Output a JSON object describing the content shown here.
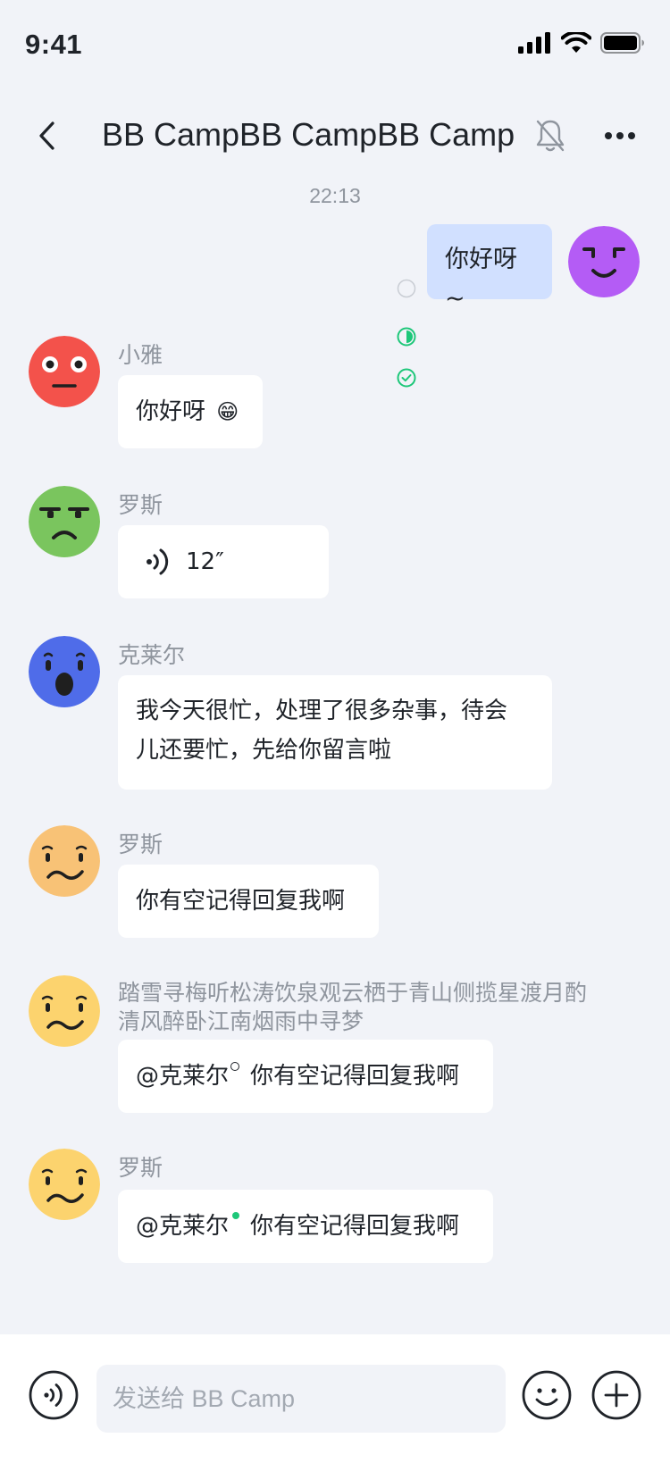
{
  "status_bar": {
    "time": "9:41"
  },
  "nav": {
    "title": "BB CampBB CampBB Camp"
  },
  "chat": {
    "timestamp": "22:13",
    "messages": [
      {
        "sender": "",
        "text": "你好呀~",
        "mine": true
      },
      {
        "sender": "小雅",
        "text": "你好呀",
        "emoji": "😁"
      },
      {
        "sender": "罗斯",
        "voice_duration": "12″"
      },
      {
        "sender": "克莱尔",
        "line1": "我今天很忙，处理了很多杂事，待会",
        "line2": "儿还要忙，先给你留言啦"
      },
      {
        "sender": "罗斯",
        "text": "你有空记得回复我啊"
      },
      {
        "sender_line1": "踏雪寻梅听松涛饮泉观云栖于青山侧揽星渡月酌",
        "sender_line2": "清风醉卧江南烟雨中寻梦",
        "mention": "@克莱尔",
        "text": "你有空记得回复我啊"
      },
      {
        "sender": "罗斯",
        "mention": "@克莱尔",
        "text": "你有空记得回复我啊"
      }
    ]
  },
  "input_bar": {
    "placeholder": "发送给 BB Camp"
  },
  "colors": {
    "accent_green": "#1DC779",
    "mine_bubble": "#D1E0FF",
    "background": "#F1F3F8"
  }
}
